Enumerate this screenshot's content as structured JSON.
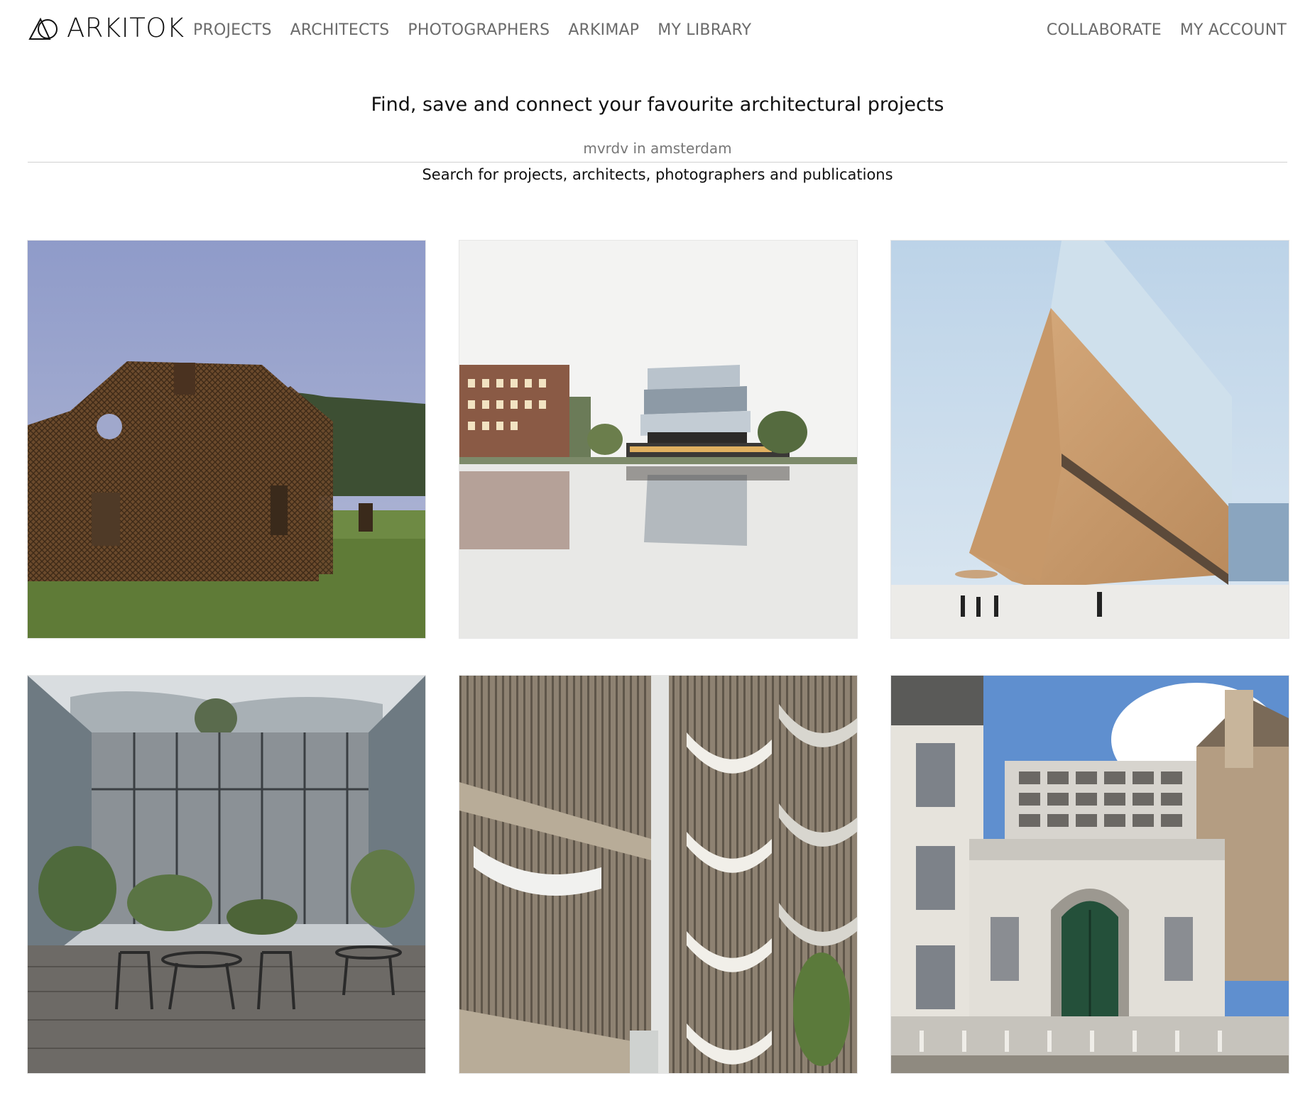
{
  "brand": {
    "name": "ARKITOK",
    "logo_icon": "arkitok-logo-icon"
  },
  "nav": {
    "left": [
      {
        "label": "PROJECTS",
        "name": "nav-projects"
      },
      {
        "label": "ARCHITECTS",
        "name": "nav-architects"
      },
      {
        "label": "PHOTOGRAPHERS",
        "name": "nav-photographers"
      },
      {
        "label": "ARKIMAP",
        "name": "nav-arkimap"
      },
      {
        "label": "MY LIBRARY",
        "name": "nav-my-library"
      }
    ],
    "right": [
      {
        "label": "COLLABORATE",
        "name": "nav-collaborate"
      },
      {
        "label": "MY ACCOUNT",
        "name": "nav-my-account"
      }
    ]
  },
  "hero": {
    "tagline": "Find, save and connect your favourite architectural projects"
  },
  "search": {
    "placeholder": "mvrdv in amsterdam",
    "hint": "Search for projects, architects, photographers and publications"
  },
  "colors": {
    "nav_text": "#6b6b6b",
    "text": "#111111",
    "divider": "#d0d0d0"
  },
  "projects": [
    {
      "image": "rusted-wire-house-photo"
    },
    {
      "image": "glass-museum-waterfront-photo"
    },
    {
      "image": "timber-clad-library-photo"
    },
    {
      "image": "glass-courtyard-cafe-photo"
    },
    {
      "image": "scalloped-balcony-facade-photo"
    },
    {
      "image": "historic-gate-modern-addition-photo"
    }
  ]
}
